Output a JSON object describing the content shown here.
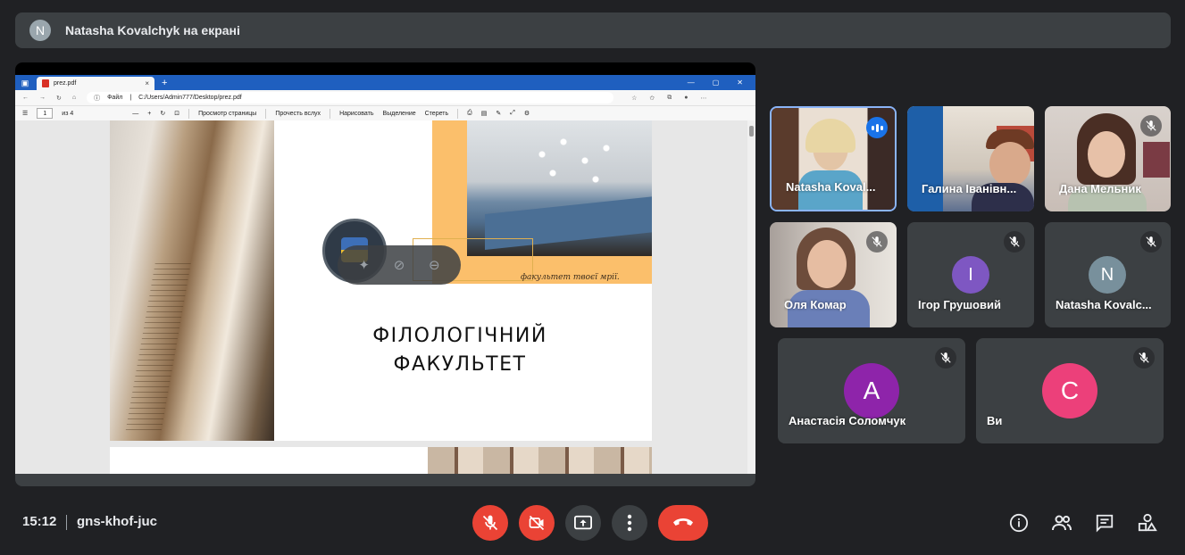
{
  "banner": {
    "avatar_letter": "N",
    "text": "Natasha Kovalchyk на екрані"
  },
  "browser": {
    "tab_title": "prez.pdf",
    "tab_close": "×",
    "new_tab": "+",
    "address_prefix": "Файл",
    "address": "C:/Users/Admin777/Desktop/prez.pdf",
    "page_number": "1",
    "page_of": "из 4",
    "view_label": "Просмотр страницы",
    "read_aloud": "Прочесть вслух",
    "draw": "Нарисовать",
    "highlight": "Выделение",
    "erase": "Стереть"
  },
  "slide": {
    "caption": "факультет твоєї мрії.",
    "title_line1": "ФІЛОЛОГІЧНИЙ",
    "title_line2": "ФАКУЛЬТЕТ"
  },
  "participants": [
    {
      "name": "Natasha Koval...",
      "state": "speaking"
    },
    {
      "name": "Галина Іванівн...",
      "state": "video"
    },
    {
      "name": "Дана Мельник",
      "state": "muted"
    },
    {
      "name": "Оля Комар",
      "state": "muted"
    },
    {
      "name": "Ігор Грушовий",
      "letter": "I",
      "color": "#7e57c2",
      "state": "muted"
    },
    {
      "name": "Natasha Kovalc...",
      "letter": "N",
      "color": "#78909c",
      "state": "muted"
    },
    {
      "name": "Анастасія Соломчук",
      "letter": "A",
      "color": "#8e24aa",
      "state": "muted"
    },
    {
      "name": "Ви",
      "letter": "C",
      "color": "#ec407a",
      "state": "muted"
    }
  ],
  "bottom": {
    "time": "15:12",
    "meeting_code": "gns-khof-juc",
    "icons": [
      "mic-off-icon",
      "camera-off-icon",
      "present-icon",
      "more-icon",
      "hangup-icon",
      "info-icon",
      "people-icon",
      "chat-icon",
      "activities-icon"
    ]
  },
  "colors": {
    "background": "#202124",
    "tile": "#3c4043",
    "accent": "#8ab4f8",
    "danger": "#ea4335"
  }
}
